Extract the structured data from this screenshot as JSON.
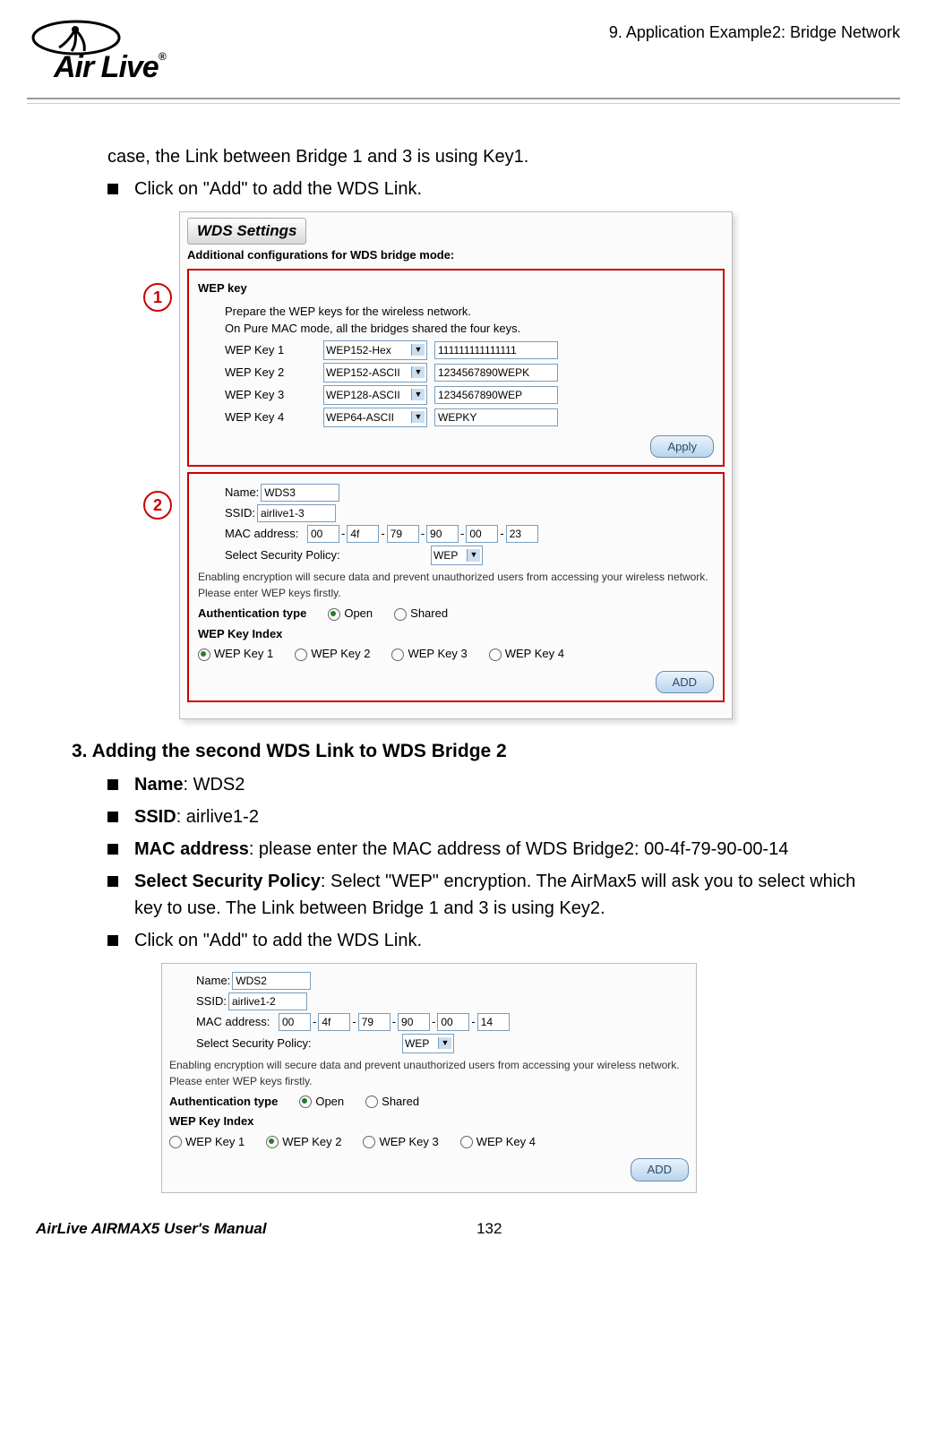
{
  "header": {
    "logo_text": "Air Live",
    "chapter": "9. Application Example2: Bridge Network"
  },
  "body": {
    "intro_line": "case, the Link between Bridge 1 and 3 is using Key1.",
    "bullet_click_add": "Click on \"Add\" to add the WDS Link.",
    "callout1": "1",
    "callout2": "2",
    "step3_heading": "3.    Adding the second WDS Link to WDS Bridge 2",
    "b_name_label": "Name",
    "b_name_value": ": WDS2",
    "b_ssid_label": "SSID",
    "b_ssid_value": ": airlive1-2",
    "b_mac_label": "MAC address",
    "b_mac_value": ": please enter the MAC address of WDS Bridge2: 00-4f-79-90-00-14",
    "b_sec_label": "Select Security Policy",
    "b_sec_value": ":   Select \"WEP\" encryption.   The AirMax5 will ask you to select which key to use.   The Link between Bridge 1 and 3 is using Key2.",
    "bullet_click_add2": "Click on \"Add\" to add the WDS Link."
  },
  "panel1": {
    "title": "WDS Settings",
    "subtitle": "Additional configurations for WDS bridge mode:",
    "wep_section": "WEP key",
    "wep_line1": "Prepare the WEP keys for the wireless network.",
    "wep_line2": "On Pure MAC mode, all the bridges shared the four keys.",
    "keys": [
      {
        "label": "WEP Key 1",
        "type": "WEP152-Hex",
        "val": "111111111111111"
      },
      {
        "label": "WEP Key 2",
        "type": "WEP152-ASCII",
        "val": "1234567890WEPK"
      },
      {
        "label": "WEP Key 3",
        "type": "WEP128-ASCII",
        "val": "1234567890WEP"
      },
      {
        "label": "WEP Key 4",
        "type": "WEP64-ASCII",
        "val": "WEPKY"
      }
    ],
    "apply": "Apply",
    "name_label": "Name:",
    "name_val": "WDS3",
    "ssid_label": "SSID:",
    "ssid_val": "airlive1-3",
    "mac_label": "MAC address:",
    "mac": [
      "00",
      "4f",
      "79",
      "90",
      "00",
      "23"
    ],
    "sec_label": "Select Security Policy:",
    "sec_val": "WEP",
    "note": "Enabling encryption will secure data and prevent unauthorized users from accessing your wireless network. Please enter WEP keys firstly.",
    "auth_label": "Authentication type",
    "open": "Open",
    "shared": "Shared",
    "keyidx_label": "WEP Key Index",
    "k1": "WEP Key 1",
    "k2": "WEP Key 2",
    "k3": "WEP Key 3",
    "k4": "WEP Key 4",
    "add": "ADD"
  },
  "panel2": {
    "name_label": "Name:",
    "name_val": "WDS2",
    "ssid_label": "SSID:",
    "ssid_val": "airlive1-2",
    "mac_label": "MAC address:",
    "mac": [
      "00",
      "4f",
      "79",
      "90",
      "00",
      "14"
    ],
    "sec_label": "Select Security Policy:",
    "sec_val": "WEP",
    "note": "Enabling encryption will secure data and prevent unauthorized users from accessing your wireless network. Please enter WEP keys firstly.",
    "auth_label": "Authentication type",
    "open": "Open",
    "shared": "Shared",
    "keyidx_label": "WEP Key Index",
    "k1": "WEP Key 1",
    "k2": "WEP Key 2",
    "k3": "WEP Key 3",
    "k4": "WEP Key 4",
    "add": "ADD"
  },
  "footer": {
    "manual": "AirLive AIRMAX5 User's Manual",
    "page": "132"
  }
}
